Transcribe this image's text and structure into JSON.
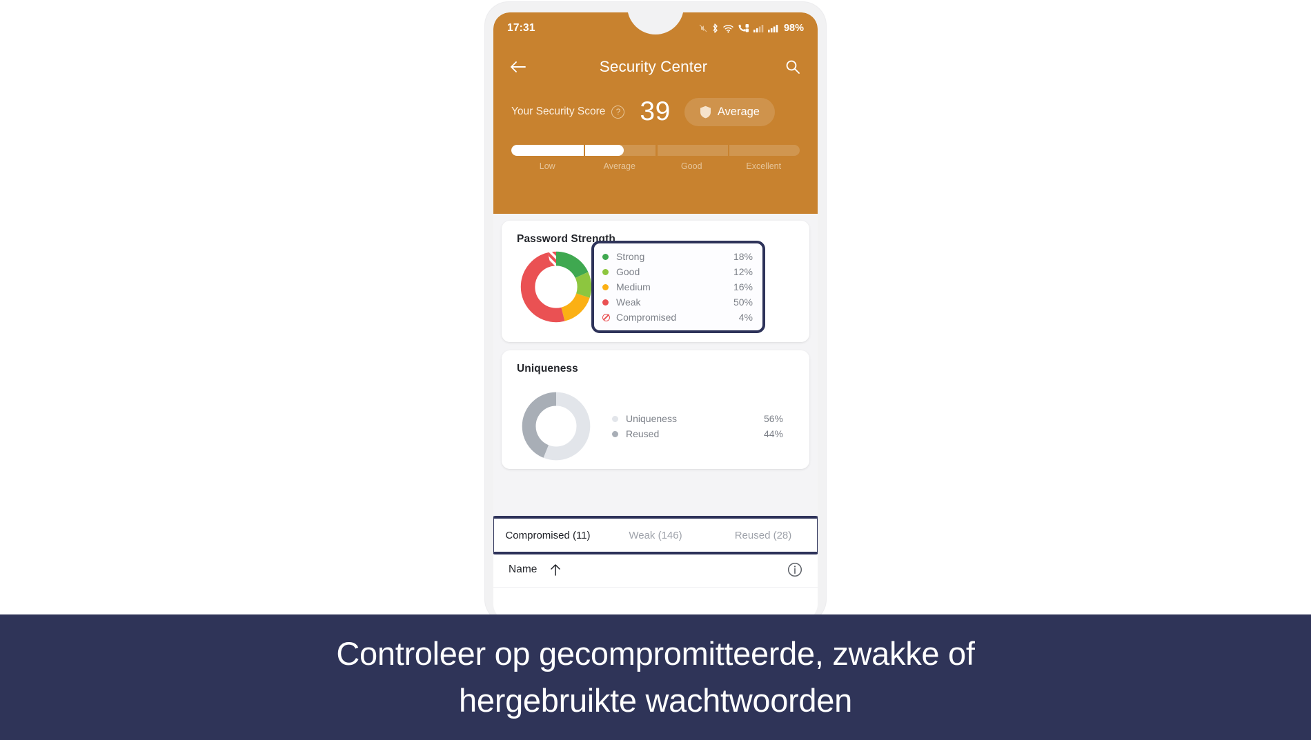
{
  "status_bar": {
    "time": "17:31",
    "battery": "98%",
    "icons": [
      "mute-icon",
      "bluetooth-icon",
      "wifi-icon",
      "call-data-icon",
      "signal-icon-1",
      "signal-icon-2"
    ]
  },
  "app_bar": {
    "back_icon": "back-arrow-icon",
    "title": "Security Center",
    "search_icon": "search-icon"
  },
  "score": {
    "label": "Your Security Score",
    "help_glyph": "?",
    "value": "39",
    "badge_label": "Average",
    "badge_icon": "shield-icon",
    "fill_percent": 39,
    "segments": [
      "Low",
      "Average",
      "Good",
      "Excellent"
    ]
  },
  "password_strength": {
    "title": "Password Strength",
    "legend": [
      {
        "label": "Strong",
        "value": "18%",
        "color": "#3fa850"
      },
      {
        "label": "Good",
        "value": "12%",
        "color": "#8dc63f"
      },
      {
        "label": "Medium",
        "value": "16%",
        "color": "#fbb014"
      },
      {
        "label": "Weak",
        "value": "50%",
        "color": "#ea5153"
      },
      {
        "label": "Compromised",
        "value": "4%",
        "color": "#ea5153"
      }
    ]
  },
  "uniqueness": {
    "title": "Uniqueness",
    "legend": [
      {
        "label": "Uniqueness",
        "value": "56%",
        "color": "#e2e5ea"
      },
      {
        "label": "Reused",
        "value": "44%",
        "color": "#a8aeb6"
      }
    ]
  },
  "tabs": [
    {
      "label": "Compromised (11)",
      "active": true
    },
    {
      "label": "Weak (146)",
      "active": false
    },
    {
      "label": "Reused (28)",
      "active": false
    }
  ],
  "list_header": {
    "name_label": "Name",
    "sort_icon": "sort-ascending-arrow-icon",
    "info_icon": "info-circle-icon"
  },
  "caption": {
    "line1": "Controleer op gecompromitteerde, zwakke of",
    "line2": "hergebruikte wachtwoorden"
  },
  "colors": {
    "brand_orange": "#c8822f",
    "highlight_navy": "#2d3259",
    "caption_bg": "#2f3458"
  },
  "chart_data": [
    {
      "type": "pie",
      "title": "Password Strength",
      "labels": [
        "Strong",
        "Good",
        "Medium",
        "Weak",
        "Compromised"
      ],
      "values": [
        18,
        12,
        16,
        50,
        4
      ],
      "colors": [
        "#3fa850",
        "#8dc63f",
        "#fbb014",
        "#ea5153",
        "#ea5153"
      ],
      "unit": "%",
      "legend": "right",
      "donut": true
    },
    {
      "type": "pie",
      "title": "Uniqueness",
      "labels": [
        "Uniqueness",
        "Reused"
      ],
      "values": [
        56,
        44
      ],
      "colors": [
        "#e2e5ea",
        "#a8aeb6"
      ],
      "unit": "%",
      "legend": "right",
      "donut": true
    }
  ]
}
